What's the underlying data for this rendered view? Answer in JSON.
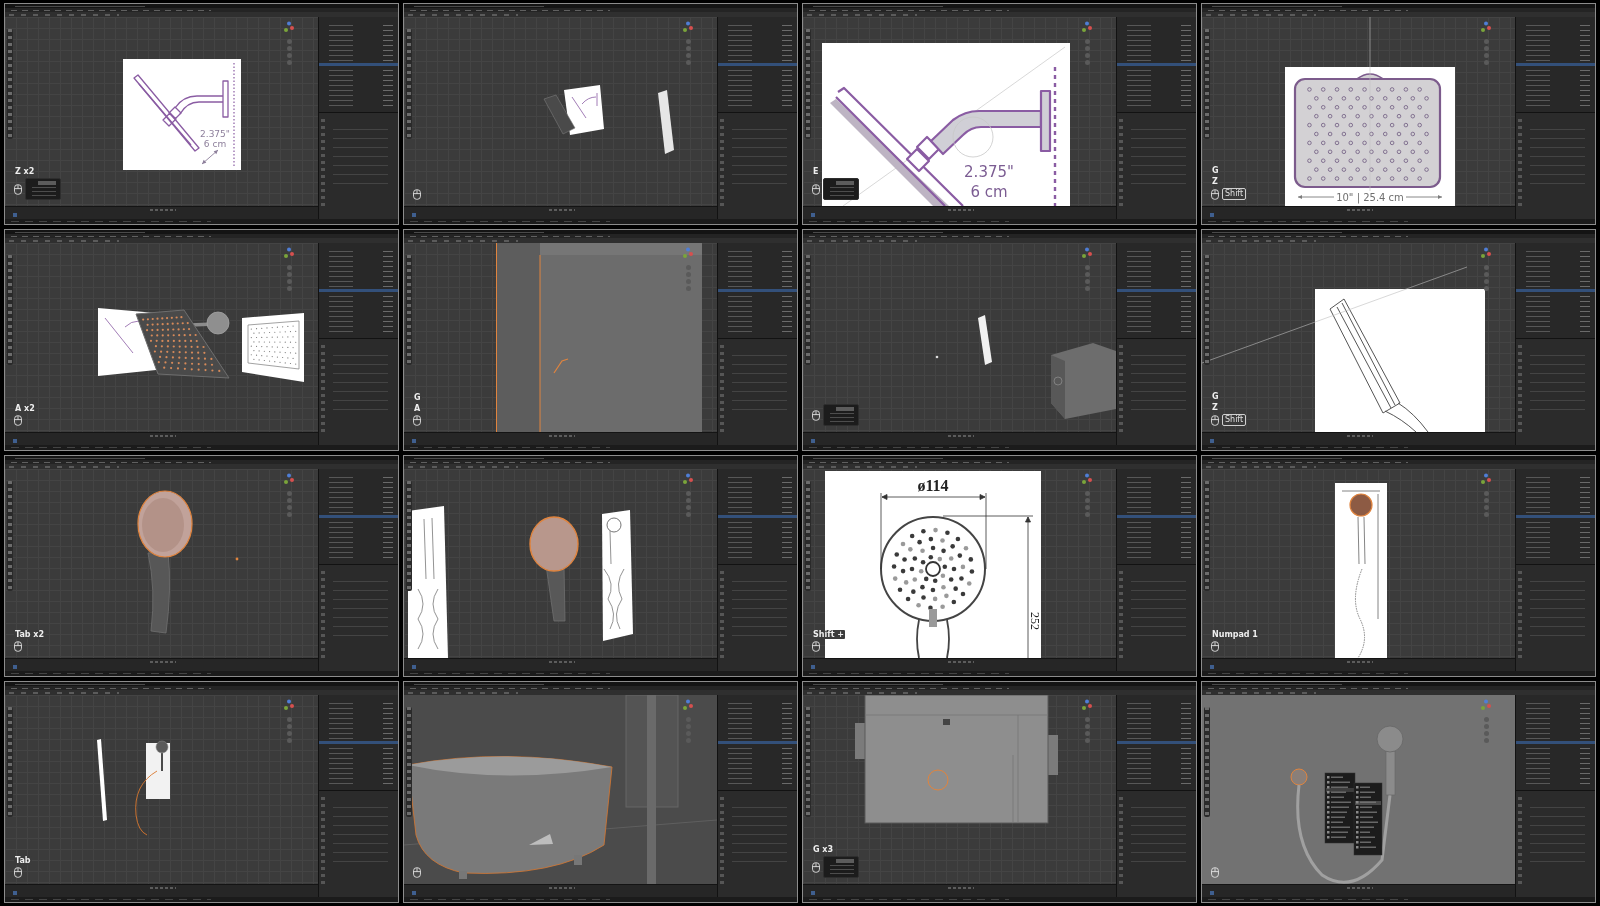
{
  "frames": [
    {
      "kind": "side_reference",
      "labels": [
        "2.375\"",
        "6 cm"
      ],
      "keys": [
        "Z x2"
      ],
      "mouse": true,
      "redo_panel": true
    },
    {
      "kind": "small_objects",
      "mouse": true,
      "redo_panel": false
    },
    {
      "kind": "side_reference_zoomed",
      "labels": [
        "2.375\"",
        "6 cm"
      ],
      "keys": [
        "E"
      ],
      "mouse": true,
      "redo_panel": true
    },
    {
      "kind": "front_reference",
      "labels": [
        "10\" | 25.4 cm"
      ],
      "keys": [
        "G",
        "Z"
      ],
      "modifier": "Shift",
      "mouse": true,
      "redo_panel": false
    },
    {
      "kind": "square_head_scene",
      "keys": [
        "A x2"
      ],
      "mouse": true,
      "redo_panel": false
    },
    {
      "kind": "mesh_wall",
      "keys": [
        "G",
        "A"
      ],
      "mouse": true,
      "redo_panel": false
    },
    {
      "kind": "tile_scene",
      "mouse": true,
      "redo_panel": true
    },
    {
      "kind": "handheld_side_reference",
      "keys": [
        "G",
        "Z"
      ],
      "modifier": "Shift",
      "mouse": true,
      "redo_panel": false
    },
    {
      "kind": "handheld_3d",
      "keys": [
        "Tab x2"
      ],
      "mouse": true,
      "redo_panel": false
    },
    {
      "kind": "handheld_refs",
      "mouse": false,
      "redo_panel": false
    },
    {
      "kind": "handheld_front_reference",
      "labels": [
        "ø114",
        "252"
      ],
      "keys": [
        "Shift +"
      ],
      "mouse": true,
      "redo_panel": false
    },
    {
      "kind": "handheld_small_reference",
      "keys": [
        "Numpad 1"
      ],
      "mouse": true,
      "redo_panel": false
    },
    {
      "kind": "hose_scene",
      "keys": [
        "Tab"
      ],
      "mouse": true,
      "redo_panel": false
    },
    {
      "kind": "bathtub",
      "mouse": true,
      "redo_panel": false
    },
    {
      "kind": "room_top",
      "keys": [
        "G x3"
      ],
      "mouse": true,
      "redo_panel": true
    },
    {
      "kind": "hose_context_menu",
      "mouse": true,
      "redo_panel": false
    }
  ]
}
